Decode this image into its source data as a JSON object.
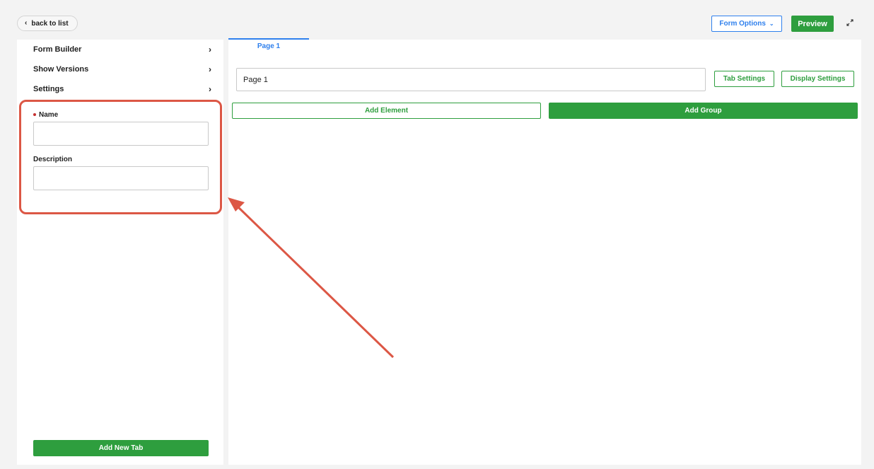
{
  "header": {
    "back_label": "back to list",
    "form_options_label": "Form Options",
    "preview_label": "Preview"
  },
  "sidebar": {
    "items": [
      {
        "label": "Form Builder"
      },
      {
        "label": "Show Versions"
      },
      {
        "label": "Settings"
      }
    ],
    "settings": {
      "name_label": "Name",
      "name_value": "",
      "description_label": "Description",
      "description_value": ""
    },
    "add_tab_label": "Add New Tab"
  },
  "main": {
    "tabs": [
      {
        "label": "Page 1",
        "active": true
      }
    ],
    "page_name_value": "Page 1",
    "tab_settings_label": "Tab Settings",
    "display_settings_label": "Display Settings",
    "add_element_label": "Add Element",
    "add_group_label": "Add Group"
  },
  "colors": {
    "accent_blue": "#2f80ed",
    "primary_green": "#2e9e3e",
    "annotation_red": "#dc5745",
    "required_red": "#c53030"
  }
}
